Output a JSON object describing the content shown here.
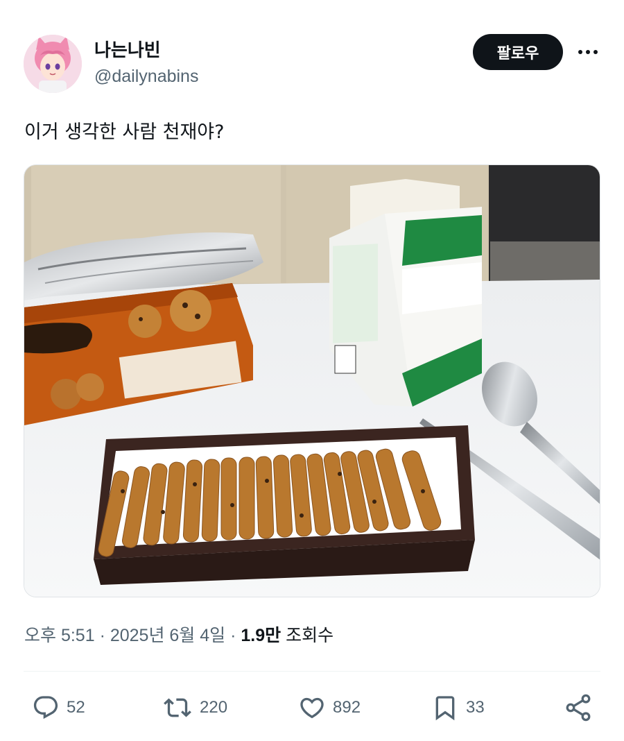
{
  "author": {
    "display_name": "나는나빈",
    "handle": "@dailynabins"
  },
  "follow_label": "팔로우",
  "tweet_text": "이거 생각한 사람 천재야?",
  "meta": {
    "time": "오후 5:51",
    "sep1": "·",
    "date": "2025년 6월 4일",
    "sep2": "·",
    "views_count": "1.9만",
    "views_label": "조회수"
  },
  "actions": {
    "replies": "52",
    "reposts": "220",
    "likes": "892",
    "bookmarks": "33"
  },
  "icons": [
    "more-icon",
    "reply-icon",
    "repost-icon",
    "like-icon",
    "bookmark-icon",
    "share-icon"
  ],
  "colors": {
    "text": "#0f1419",
    "secondary": "#536471",
    "follow_bg": "#0f1419"
  }
}
